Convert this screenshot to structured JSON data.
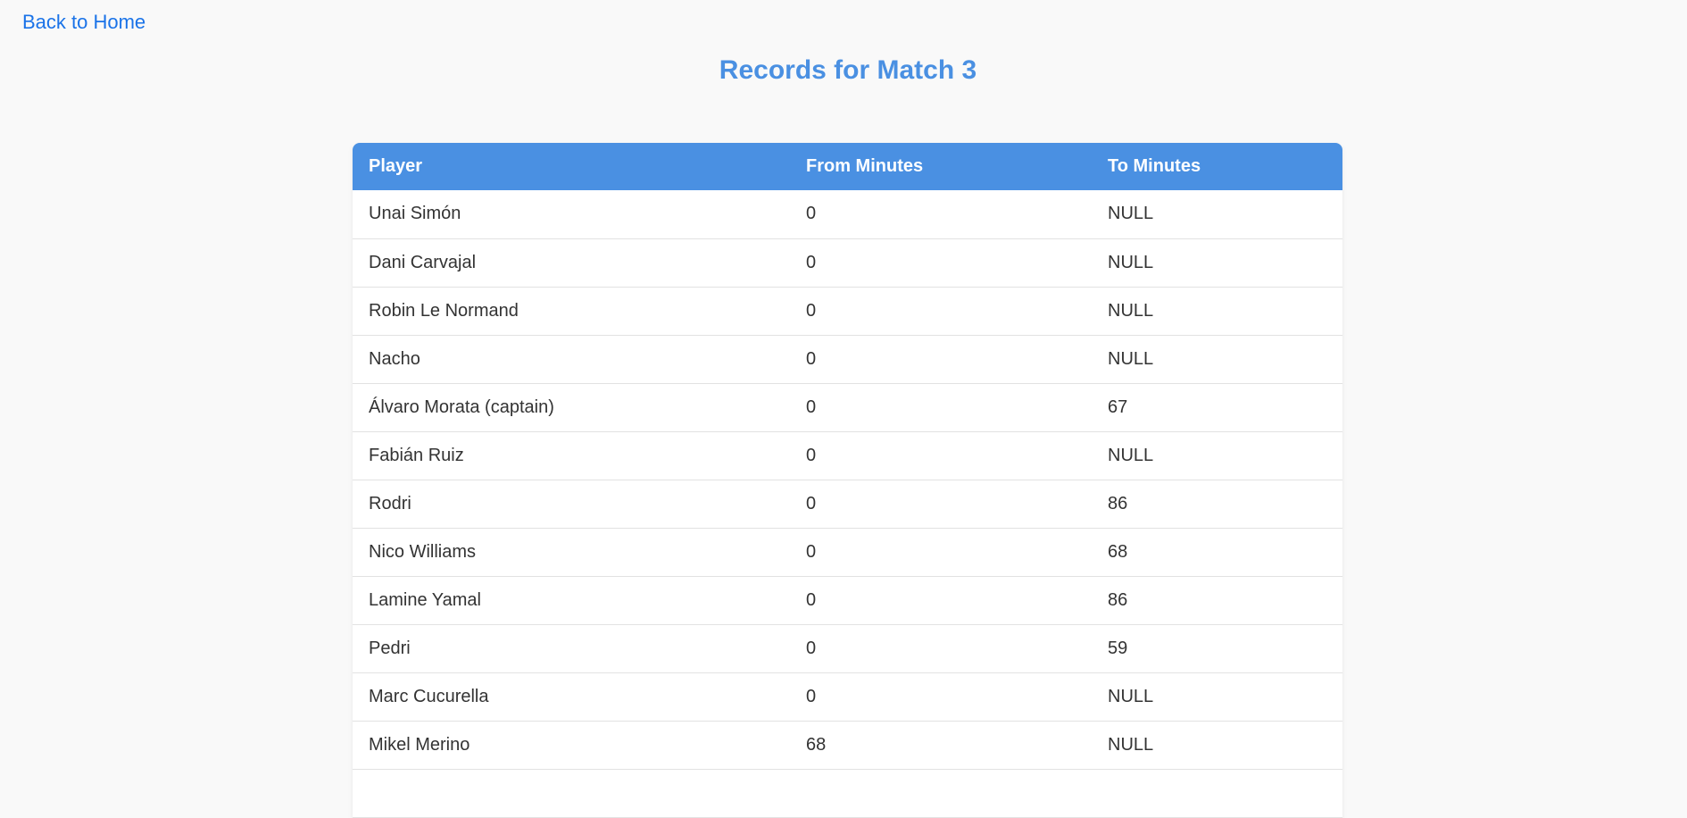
{
  "nav": {
    "back_label": "Back to Home"
  },
  "page": {
    "title": "Records for Match 3"
  },
  "table": {
    "columns": [
      "Player",
      "From Minutes",
      "To Minutes"
    ],
    "rows": [
      [
        "Unai Simón",
        "0",
        "NULL"
      ],
      [
        "Dani Carvajal",
        "0",
        "NULL"
      ],
      [
        "Robin Le Normand",
        "0",
        "NULL"
      ],
      [
        "Nacho",
        "0",
        "NULL"
      ],
      [
        "Álvaro Morata (captain)",
        "0",
        "67"
      ],
      [
        "Fabián Ruiz",
        "0",
        "NULL"
      ],
      [
        "Rodri",
        "0",
        "86"
      ],
      [
        "Nico Williams",
        "0",
        "68"
      ],
      [
        "Lamine Yamal",
        "0",
        "86"
      ],
      [
        "Pedri",
        "0",
        "59"
      ],
      [
        "Marc Cucurella",
        "0",
        "NULL"
      ],
      [
        "Mikel Merino",
        "68",
        "NULL"
      ],
      [
        "",
        "",
        ""
      ]
    ]
  },
  "colors": {
    "accent": "#4a90e2",
    "link": "#1a73e8",
    "background": "#f9f9f9",
    "text": "#333333"
  }
}
